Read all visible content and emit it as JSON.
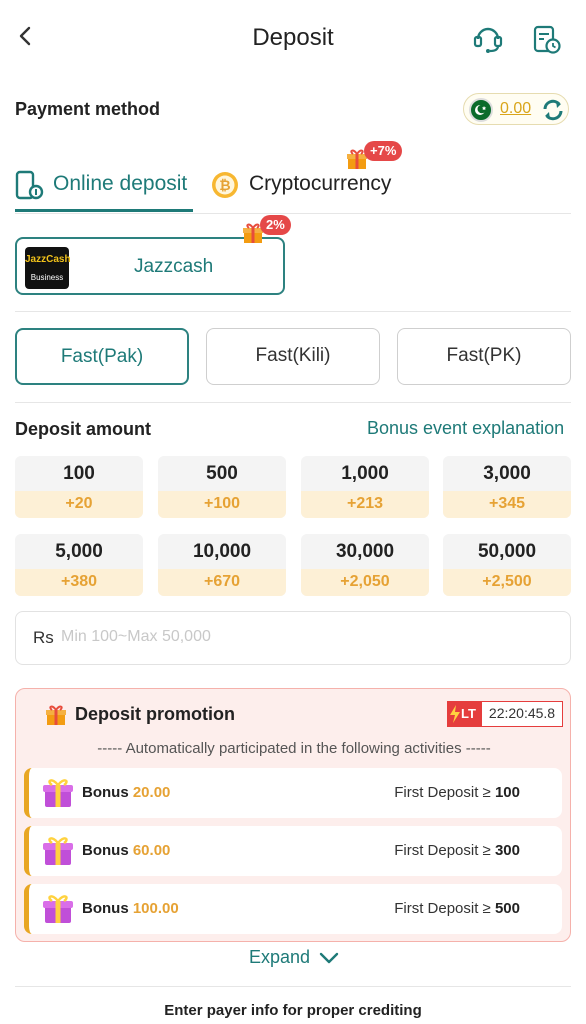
{
  "header": {
    "title": "Deposit"
  },
  "payment": {
    "label": "Payment method",
    "balance": "0.00"
  },
  "tabs": [
    {
      "label": "Online deposit",
      "active": true
    },
    {
      "label": "Cryptocurrency",
      "badge": "+7%"
    }
  ],
  "channel": {
    "logo_line1": "JazzCash",
    "logo_line2": "Business",
    "name": "Jazzcash",
    "badge": "2%"
  },
  "sub_channels": [
    {
      "label": "Fast(Pak)",
      "active": true
    },
    {
      "label": "Fast(Kili)"
    },
    {
      "label": "Fast(PK)"
    }
  ],
  "deposit": {
    "label": "Deposit amount",
    "bonus_link": "Bonus event explanation",
    "amounts": [
      {
        "value": "100",
        "bonus": "+20"
      },
      {
        "value": "500",
        "bonus": "+100"
      },
      {
        "value": "1,000",
        "bonus": "+213"
      },
      {
        "value": "3,000",
        "bonus": "+345"
      },
      {
        "value": "5,000",
        "bonus": "+380"
      },
      {
        "value": "10,000",
        "bonus": "+670"
      },
      {
        "value": "30,000",
        "bonus": "+2,050"
      },
      {
        "value": "50,000",
        "bonus": "+2,500"
      }
    ],
    "currency": "Rs",
    "placeholder": "Min 100~Max 50,000"
  },
  "promotion": {
    "title": "Deposit promotion",
    "lt_label": "LT",
    "timer": "22:20:45.8",
    "note": "----- Automatically participated in the following activities -----",
    "rows": [
      {
        "bonus_label": "Bonus",
        "bonus_amount": "20.00",
        "condition": "First Deposit ≥",
        "min": "100"
      },
      {
        "bonus_label": "Bonus",
        "bonus_amount": "60.00",
        "condition": "First Deposit ≥",
        "min": "300"
      },
      {
        "bonus_label": "Bonus",
        "bonus_amount": "100.00",
        "condition": "First Deposit ≥",
        "min": "500"
      }
    ],
    "expand": "Expand"
  },
  "footer": {
    "note": "Enter payer info for proper crediting"
  },
  "colors": {
    "primary": "#1e7a78",
    "bonus": "#e6a234",
    "badge": "#e54848"
  }
}
